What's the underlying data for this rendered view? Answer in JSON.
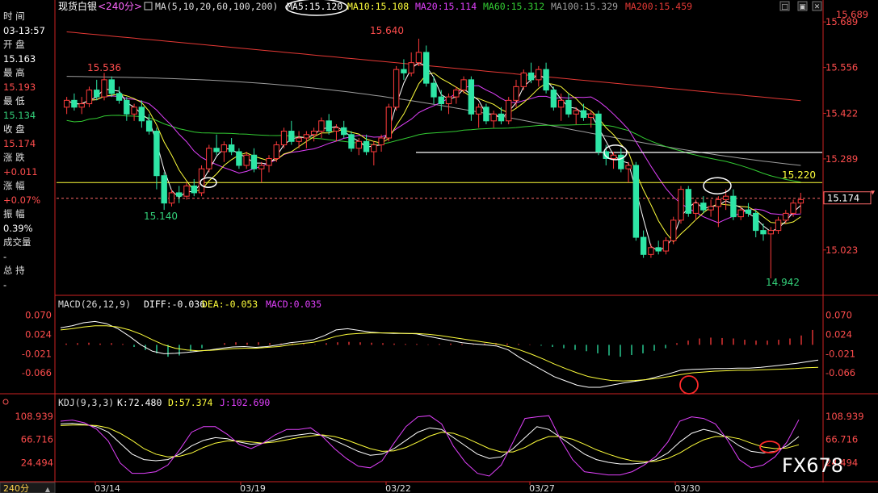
{
  "header": {
    "symbol": "现货白银",
    "period": "<240分>",
    "ma_label": "MA(5,10,20,60,100,200)",
    "ma5": "MA5:15.120",
    "ma10": "MA10:15.108",
    "ma20": "MA20:15.114",
    "ma60": "MA60:15.312",
    "ma100": "MA100:15.329",
    "ma200": "MA200:15.459"
  },
  "left_panel": {
    "time_label": "时 间",
    "time_value": "03-13:57",
    "open_label": "开 盘",
    "open_value": "15.163",
    "high_label": "最 高",
    "high_value": "15.193",
    "low_label": "最 低",
    "low_value": "15.134",
    "close_label": "收 盘",
    "close_value": "15.174",
    "change_label": "涨 跌",
    "change_value": "+0.011",
    "pct_label": "涨 幅",
    "pct_value": "+0.07%",
    "amp_label": "振 幅",
    "amp_value": "0.39%",
    "vol_label": "成交量",
    "vol_value": "-",
    "oi_label": "总 持",
    "oi_value": "-"
  },
  "macd_header": {
    "title": "MACD(26,12,9)",
    "diff": "DIFF:-0.036",
    "dea": "DEA:-0.053",
    "macd": "MACD:0.035"
  },
  "kdj_header": {
    "title": "KDJ(9,3,3)",
    "k": "K:72.480",
    "d": "D:57.374",
    "j": "J:102.690"
  },
  "bottom": {
    "period_button": "240分",
    "dates": [
      "03/14",
      "03/19",
      "03/22",
      "03/27",
      "03/30"
    ]
  },
  "annotations": {
    "high_label": "15.640",
    "left_high_label": "15.536",
    "left_low_label": "15.140",
    "right_low_label": "14.942",
    "resistance_label": "15.220",
    "current_price_box": "15.174"
  },
  "watermark": "FX678",
  "colors": {
    "up": "#ff3b3b",
    "down": "#2ee6a6",
    "ma5": "#ffffff",
    "ma10": "#ffff3b",
    "ma20": "#e040fb",
    "ma60": "#33cc33",
    "ma100": "#9e9e9e",
    "ma200": "#e53935",
    "axis": "#cc2222",
    "yaxis_text": "#ff4d4d"
  },
  "chart_data": [
    {
      "type": "candlestick",
      "title": "现货白银<240分>",
      "ylim": [
        14.9,
        15.72
      ],
      "yticks": [
        15.689,
        15.556,
        15.422,
        15.289,
        15.023
      ],
      "hlines": [
        15.22
      ],
      "labeled_points": [
        {
          "label": "15.640",
          "value": 15.64
        },
        {
          "label": "15.536",
          "value": 15.536
        },
        {
          "label": "15.140",
          "value": 15.14
        },
        {
          "label": "14.942",
          "value": 14.942
        }
      ],
      "candles": [
        [
          15.44,
          15.47,
          15.42,
          15.46
        ],
        [
          15.46,
          15.48,
          15.43,
          15.44
        ],
        [
          15.44,
          15.47,
          15.42,
          15.45
        ],
        [
          15.45,
          15.5,
          15.44,
          15.49
        ],
        [
          15.49,
          15.52,
          15.46,
          15.47
        ],
        [
          15.47,
          15.54,
          15.46,
          15.52
        ],
        [
          15.52,
          15.53,
          15.47,
          15.48
        ],
        [
          15.48,
          15.5,
          15.45,
          15.46
        ],
        [
          15.46,
          15.47,
          15.4,
          15.42
        ],
        [
          15.42,
          15.45,
          15.4,
          15.44
        ],
        [
          15.44,
          15.46,
          15.38,
          15.4
        ],
        [
          15.4,
          15.42,
          15.36,
          15.37
        ],
        [
          15.37,
          15.38,
          15.2,
          15.24
        ],
        [
          15.24,
          15.25,
          15.14,
          15.16
        ],
        [
          15.16,
          15.2,
          15.15,
          15.19
        ],
        [
          15.19,
          15.21,
          15.16,
          15.18
        ],
        [
          15.18,
          15.22,
          15.17,
          15.21
        ],
        [
          15.21,
          15.23,
          15.18,
          15.19
        ],
        [
          15.19,
          15.27,
          15.18,
          15.26
        ],
        [
          15.26,
          15.33,
          15.25,
          15.32
        ],
        [
          15.32,
          15.36,
          15.3,
          15.31
        ],
        [
          15.31,
          15.34,
          15.28,
          15.33
        ],
        [
          15.33,
          15.35,
          15.3,
          15.31
        ],
        [
          15.31,
          15.32,
          15.26,
          15.27
        ],
        [
          15.27,
          15.31,
          15.26,
          15.3
        ],
        [
          15.3,
          15.32,
          15.25,
          15.26
        ],
        [
          15.26,
          15.28,
          15.22,
          15.27
        ],
        [
          15.27,
          15.3,
          15.25,
          15.29
        ],
        [
          15.29,
          15.34,
          15.28,
          15.33
        ],
        [
          15.33,
          15.38,
          15.32,
          15.37
        ],
        [
          15.37,
          15.4,
          15.33,
          15.34
        ],
        [
          15.34,
          15.37,
          15.32,
          15.35
        ],
        [
          15.35,
          15.37,
          15.32,
          15.36
        ],
        [
          15.36,
          15.38,
          15.34,
          15.37
        ],
        [
          15.37,
          15.41,
          15.35,
          15.4
        ],
        [
          15.4,
          15.42,
          15.36,
          15.37
        ],
        [
          15.37,
          15.39,
          15.34,
          15.38
        ],
        [
          15.38,
          15.4,
          15.35,
          15.36
        ],
        [
          15.36,
          15.37,
          15.31,
          15.32
        ],
        [
          15.32,
          15.35,
          15.3,
          15.34
        ],
        [
          15.34,
          15.36,
          15.3,
          15.31
        ],
        [
          15.31,
          15.34,
          15.27,
          15.33
        ],
        [
          15.33,
          15.36,
          15.31,
          15.35
        ],
        [
          15.35,
          15.45,
          15.34,
          15.44
        ],
        [
          15.44,
          15.56,
          15.43,
          15.55
        ],
        [
          15.55,
          15.58,
          15.52,
          15.54
        ],
        [
          15.54,
          15.6,
          15.53,
          15.57
        ],
        [
          15.57,
          15.64,
          15.56,
          15.6
        ],
        [
          15.6,
          15.62,
          15.5,
          15.51
        ],
        [
          15.51,
          15.53,
          15.45,
          15.47
        ],
        [
          15.47,
          15.49,
          15.43,
          15.45
        ],
        [
          15.45,
          15.48,
          15.42,
          15.47
        ],
        [
          15.47,
          15.5,
          15.45,
          15.49
        ],
        [
          15.49,
          15.53,
          15.48,
          15.52
        ],
        [
          15.52,
          15.53,
          15.4,
          15.42
        ],
        [
          15.42,
          15.45,
          15.38,
          15.44
        ],
        [
          15.44,
          15.45,
          15.39,
          15.4
        ],
        [
          15.4,
          15.43,
          15.38,
          15.42
        ],
        [
          15.42,
          15.44,
          15.39,
          15.4
        ],
        [
          15.4,
          15.47,
          15.39,
          15.46
        ],
        [
          15.46,
          15.52,
          15.44,
          15.5
        ],
        [
          15.5,
          15.55,
          15.49,
          15.54
        ],
        [
          15.54,
          15.57,
          15.51,
          15.52
        ],
        [
          15.52,
          15.56,
          15.5,
          15.55
        ],
        [
          15.55,
          15.57,
          15.48,
          15.49
        ],
        [
          15.49,
          15.5,
          15.43,
          15.44
        ],
        [
          15.44,
          15.48,
          15.4,
          15.46
        ],
        [
          15.46,
          15.48,
          15.41,
          15.42
        ],
        [
          15.42,
          15.44,
          15.39,
          15.43
        ],
        [
          15.43,
          15.45,
          15.4,
          15.41
        ],
        [
          15.41,
          15.43,
          15.38,
          15.42
        ],
        [
          15.42,
          15.43,
          15.3,
          15.31
        ],
        [
          15.31,
          15.33,
          15.27,
          15.29
        ],
        [
          15.29,
          15.31,
          15.26,
          15.3
        ],
        [
          15.3,
          15.32,
          15.25,
          15.26
        ],
        [
          15.26,
          15.28,
          15.22,
          15.27
        ],
        [
          15.27,
          15.28,
          15.05,
          15.06
        ],
        [
          15.06,
          15.08,
          15.0,
          15.01
        ],
        [
          15.01,
          15.04,
          15.0,
          15.03
        ],
        [
          15.03,
          15.05,
          15.01,
          15.02
        ],
        [
          15.02,
          15.06,
          15.01,
          15.05
        ],
        [
          15.05,
          15.12,
          15.04,
          15.11
        ],
        [
          15.11,
          15.21,
          15.1,
          15.2
        ],
        [
          15.2,
          15.21,
          15.12,
          15.13
        ],
        [
          15.13,
          15.17,
          15.11,
          15.16
        ],
        [
          15.16,
          15.18,
          15.13,
          15.14
        ],
        [
          15.14,
          15.17,
          15.12,
          15.15
        ],
        [
          15.15,
          15.18,
          15.09,
          15.17
        ],
        [
          15.17,
          15.2,
          15.14,
          15.18
        ],
        [
          15.18,
          15.2,
          15.11,
          15.12
        ],
        [
          15.12,
          15.15,
          15.11,
          15.14
        ],
        [
          15.14,
          15.16,
          15.12,
          15.13
        ],
        [
          15.13,
          15.14,
          15.06,
          15.08
        ],
        [
          15.08,
          15.1,
          15.05,
          15.07
        ],
        [
          15.07,
          15.09,
          14.94,
          15.08
        ],
        [
          15.08,
          15.12,
          15.07,
          15.11
        ],
        [
          15.11,
          15.14,
          15.1,
          15.13
        ],
        [
          15.13,
          15.17,
          15.12,
          15.16
        ],
        [
          15.16,
          15.19,
          15.13,
          15.17
        ]
      ]
    },
    {
      "type": "bar",
      "title": "MACD(26,12,9)",
      "ylim": [
        -0.1,
        0.09
      ],
      "yticks": [
        0.07,
        0.024,
        -0.021,
        -0.066
      ],
      "values": [
        0.003,
        0.004,
        0.005,
        0.003,
        0.004,
        0.002,
        -0.005,
        -0.012,
        -0.02,
        -0.028,
        -0.025,
        -0.015,
        -0.008,
        0.0,
        0.004,
        0.006,
        0.005,
        0.006,
        0.004,
        0.003,
        0.003,
        0.002,
        0.001,
        0.004,
        0.006,
        0.007,
        0.006,
        0.005,
        0.004,
        0.003,
        0.002,
        0.002,
        0.001,
        0.002,
        0.003,
        0.002,
        0.001,
        0.003,
        0.004,
        0.003,
        0.002,
        0.001,
        -0.002,
        -0.005,
        -0.008,
        -0.012,
        -0.015,
        -0.02,
        -0.025,
        -0.028,
        -0.024,
        -0.02,
        -0.014,
        -0.008,
        0.004,
        0.01,
        0.015,
        0.017,
        0.016,
        0.015,
        0.012,
        0.01,
        0.01,
        0.012,
        0.015,
        0.022,
        0.035
      ],
      "series": [
        {
          "name": "DIFF",
          "values": [
            0.04,
            0.045,
            0.052,
            0.055,
            0.05,
            0.038,
            0.02,
            0.0,
            -0.015,
            -0.021,
            -0.02,
            -0.018,
            -0.015,
            -0.012,
            -0.008,
            -0.005,
            -0.004,
            -0.006,
            -0.004,
            0.0,
            0.005,
            0.008,
            0.012,
            0.022,
            0.035,
            0.038,
            0.034,
            0.03,
            0.028,
            0.027,
            0.027,
            0.026,
            0.02,
            0.015,
            0.01,
            0.005,
            0.002,
            0.0,
            -0.003,
            -0.012,
            -0.03,
            -0.045,
            -0.06,
            -0.075,
            -0.085,
            -0.095,
            -0.1,
            -0.1,
            -0.095,
            -0.09,
            -0.086,
            -0.082,
            -0.075,
            -0.068,
            -0.06,
            -0.058,
            -0.057,
            -0.056,
            -0.056,
            -0.055,
            -0.055,
            -0.053,
            -0.05,
            -0.047,
            -0.044,
            -0.04,
            -0.036
          ]
        },
        {
          "name": "DEA",
          "values": [
            0.035,
            0.038,
            0.042,
            0.045,
            0.045,
            0.042,
            0.035,
            0.025,
            0.012,
            0.0,
            -0.008,
            -0.012,
            -0.014,
            -0.013,
            -0.011,
            -0.009,
            -0.008,
            -0.008,
            -0.006,
            -0.004,
            0.0,
            0.003,
            0.006,
            0.012,
            0.02,
            0.025,
            0.027,
            0.028,
            0.028,
            0.028,
            0.027,
            0.027,
            0.025,
            0.022,
            0.018,
            0.014,
            0.01,
            0.006,
            0.002,
            -0.004,
            -0.012,
            -0.022,
            -0.033,
            -0.045,
            -0.056,
            -0.066,
            -0.075,
            -0.08,
            -0.084,
            -0.085,
            -0.084,
            -0.082,
            -0.079,
            -0.075,
            -0.07,
            -0.066,
            -0.064,
            -0.062,
            -0.061,
            -0.06,
            -0.06,
            -0.059,
            -0.058,
            -0.057,
            -0.056,
            -0.054,
            -0.053
          ]
        }
      ]
    },
    {
      "type": "line",
      "title": "KDJ(9,3,3)",
      "ylim": [
        0,
        125
      ],
      "yticks": [
        108.939,
        66.716,
        24.494
      ],
      "series": [
        {
          "name": "K",
          "values": [
            95,
            96,
            94,
            90,
            80,
            60,
            40,
            30,
            28,
            30,
            40,
            55,
            65,
            70,
            68,
            62,
            58,
            60,
            66,
            72,
            75,
            78,
            74,
            65,
            55,
            45,
            38,
            40,
            50,
            65,
            80,
            88,
            85,
            70,
            55,
            40,
            32,
            35,
            50,
            70,
            90,
            85,
            70,
            55,
            40,
            30,
            25,
            22,
            22,
            24,
            30,
            42,
            62,
            78,
            85,
            80,
            70,
            55,
            45,
            42,
            45,
            55,
            72
          ]
        },
        {
          "name": "D",
          "values": [
            92,
            93,
            93,
            92,
            88,
            78,
            65,
            50,
            40,
            35,
            36,
            42,
            52,
            60,
            64,
            64,
            62,
            60,
            62,
            66,
            70,
            73,
            75,
            72,
            66,
            58,
            50,
            45,
            46,
            52,
            62,
            73,
            80,
            78,
            70,
            60,
            50,
            44,
            44,
            52,
            64,
            72,
            72,
            67,
            58,
            48,
            40,
            33,
            28,
            26,
            27,
            32,
            42,
            55,
            66,
            72,
            72,
            68,
            60,
            53,
            50,
            51,
            57
          ]
        },
        {
          "name": "J",
          "values": [
            100,
            102,
            97,
            86,
            64,
            24,
            5,
            5,
            8,
            20,
            48,
            80,
            90,
            90,
            76,
            58,
            50,
            60,
            75,
            85,
            85,
            88,
            72,
            50,
            32,
            18,
            15,
            28,
            60,
            90,
            108,
            110,
            95,
            54,
            25,
            5,
            0,
            20,
            62,
            105,
            108,
            110,
            66,
            30,
            8,
            5,
            2,
            2,
            8,
            20,
            36,
            62,
            100,
            108,
            105,
            95,
            66,
            30,
            15,
            20,
            35,
            62,
            102.69
          ]
        }
      ]
    }
  ]
}
